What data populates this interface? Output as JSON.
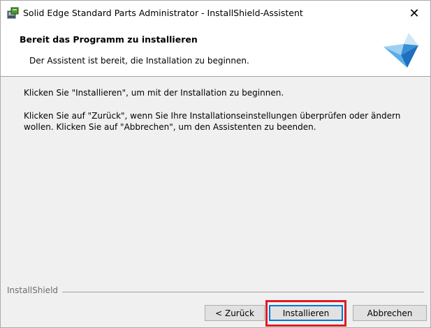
{
  "window": {
    "title": "Solid Edge Standard Parts Administrator - InstallShield-Assistent",
    "close_glyph": "✕"
  },
  "header": {
    "title": "Bereit das Programm zu installieren",
    "subtitle": "Der Assistent ist bereit, die Installation zu beginnen.",
    "logo_icon": "installshield-logo-icon"
  },
  "body": {
    "line1": "Klicken Sie \"Installieren\", um mit der Installation zu beginnen.",
    "line2": "Klicken Sie auf \"Zurück\", wenn Sie Ihre Installationseinstellungen überprüfen oder ändern",
    "line3": "wollen. Klicken Sie auf \"Abbrechen\", um den Assistenten zu beenden."
  },
  "footer": {
    "brand": "InstallShield",
    "back_label": "< Zurück",
    "install_label": "Installieren",
    "cancel_label": "Abbrechen"
  },
  "colors": {
    "highlight": "#e01b24",
    "default_button_border": "#0078d7"
  }
}
